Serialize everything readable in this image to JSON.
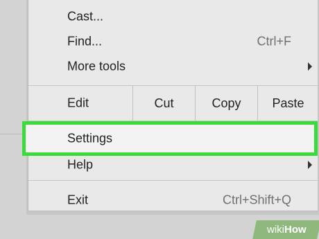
{
  "menu": {
    "cast": {
      "label": "Cast..."
    },
    "find": {
      "label": "Find...",
      "shortcut": "Ctrl+F"
    },
    "more_tools": {
      "label": "More tools"
    },
    "edit": {
      "label": "Edit",
      "cut": "Cut",
      "copy": "Copy",
      "paste": "Paste"
    },
    "settings": {
      "label": "Settings"
    },
    "help": {
      "label": "Help"
    },
    "exit": {
      "label": "Exit",
      "shortcut": "Ctrl+Shift+Q"
    }
  },
  "highlight_color": "#3bdb3b",
  "watermark": {
    "wiki": "wiki",
    "how": "How"
  },
  "icons": [
    "chevron-right-icon"
  ]
}
